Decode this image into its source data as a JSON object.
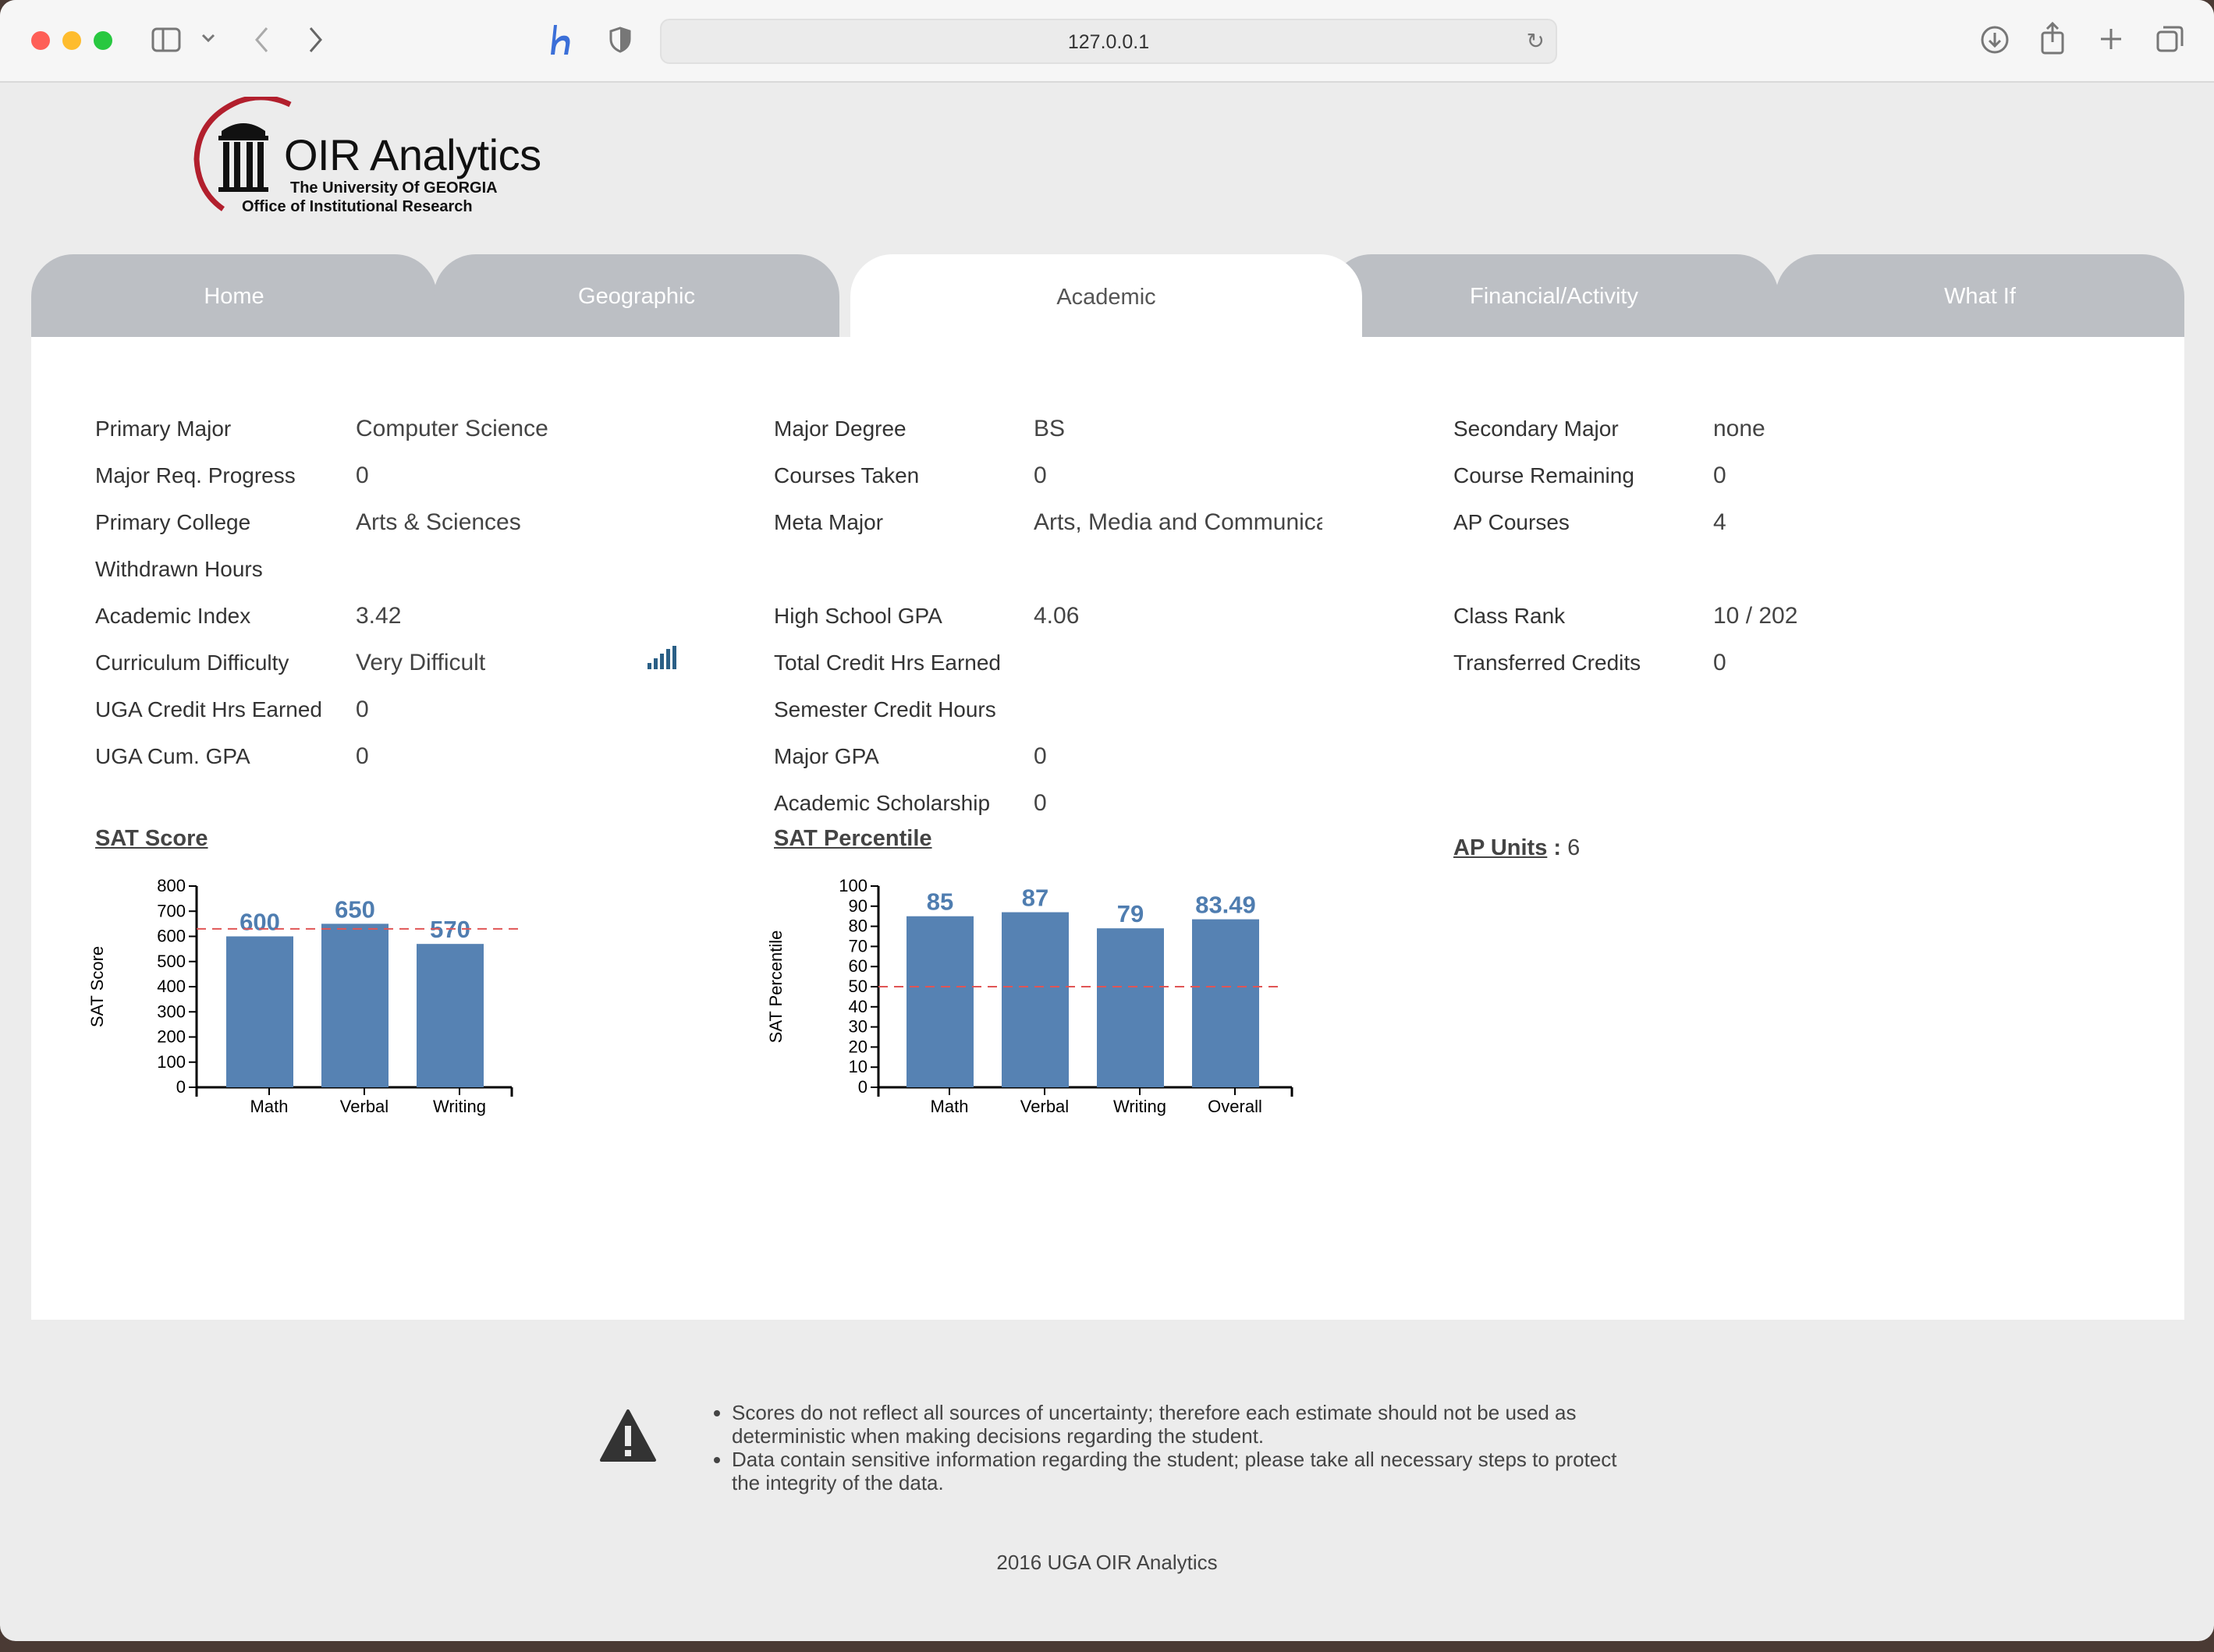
{
  "browser": {
    "url": "127.0.0.1"
  },
  "logo": {
    "title": "OIR Analytics",
    "university": "The University Of GEORGIA",
    "office": "Office of Institutional Research"
  },
  "tabs": [
    {
      "label": "Home",
      "active": false
    },
    {
      "label": "Geographic",
      "active": false
    },
    {
      "label": "Academic",
      "active": true
    },
    {
      "label": "Financial/Activity",
      "active": false
    },
    {
      "label": "What If",
      "active": false
    }
  ],
  "fields": {
    "col1": [
      {
        "label": "Primary Major",
        "value": "Computer Science"
      },
      {
        "label": "Major Req. Progress",
        "value": "0"
      },
      {
        "label": "Primary College",
        "value": "Arts & Sciences"
      },
      {
        "label": "Withdrawn Hours",
        "value": ""
      },
      {
        "label": "Academic Index",
        "value": "3.42"
      },
      {
        "label": "Curriculum Difficulty",
        "value": "Very Difficult"
      },
      {
        "label": "UGA Credit Hrs Earned",
        "value": "0"
      },
      {
        "label": "UGA Cum. GPA",
        "value": "0"
      }
    ],
    "col2": [
      {
        "label": "Major Degree",
        "value": "BS"
      },
      {
        "label": "Courses Taken",
        "value": "0"
      },
      {
        "label": "Meta Major",
        "value": "Arts, Media and Communica"
      },
      {
        "label": "High School GPA",
        "value": "4.06"
      },
      {
        "label": "Total Credit Hrs Earned",
        "value": ""
      },
      {
        "label": "Semester Credit Hours",
        "value": ""
      },
      {
        "label": "Major GPA",
        "value": "0"
      },
      {
        "label": "Academic Scholarship",
        "value": "0"
      }
    ],
    "col3": [
      {
        "label": "Secondary Major",
        "value": "none"
      },
      {
        "label": "Course Remaining",
        "value": "0"
      },
      {
        "label": "AP Courses",
        "value": "4"
      },
      {
        "label": "Class Rank",
        "value": "10 / 202"
      },
      {
        "label": "Transferred Credits",
        "value": "0"
      }
    ]
  },
  "sections": {
    "sat_score": "SAT Score",
    "sat_percentile": "SAT Percentile",
    "ap_units_label": "AP Units",
    "ap_units_sep": ":",
    "ap_units_value": "6"
  },
  "chart_data": [
    {
      "type": "bar",
      "categories": [
        "Math",
        "Verbal",
        "Writing"
      ],
      "values": [
        600,
        650,
        570
      ],
      "ylabel": "SAT Score",
      "ylim": [
        0,
        800
      ],
      "yticks": [
        0,
        100,
        200,
        300,
        400,
        500,
        600,
        700,
        800
      ],
      "reference_line": 630,
      "bar_color": "#5682b3",
      "label_color": "#4f7db0",
      "reference_color": "#e05555"
    },
    {
      "type": "bar",
      "categories": [
        "Math",
        "Verbal",
        "Writing",
        "Overall"
      ],
      "values": [
        85,
        87,
        79,
        83.49
      ],
      "ylabel": "SAT Percentile",
      "ylim": [
        0,
        100
      ],
      "yticks": [
        0,
        10,
        20,
        30,
        40,
        50,
        60,
        70,
        80,
        90,
        100
      ],
      "reference_line": 50,
      "bar_color": "#5682b3",
      "label_color": "#4f7db0",
      "reference_color": "#e05555"
    }
  ],
  "footer": {
    "notes": [
      "Scores do not reflect all sources of uncertainty; therefore each estimate should not be used as deterministic when making decisions regarding the student.",
      "Data contain sensitive information regarding the student; please take all necessary steps to protect the integrity of the data."
    ],
    "copyright": "2016 UGA OIR Analytics"
  },
  "icons": {
    "warning": "warning-icon",
    "difficulty": "signal-bars-icon"
  }
}
